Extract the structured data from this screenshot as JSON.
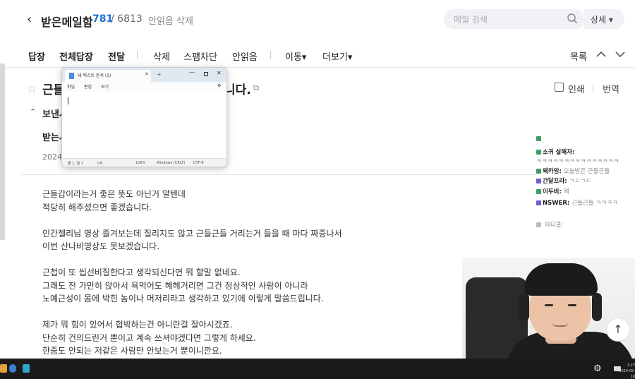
{
  "header": {
    "back_icon": "chevron-left-icon",
    "folder": "받은메일함",
    "unread_count": "781",
    "total_count": "/ 6813",
    "delete_unread": "안읽음 삭제",
    "search_placeholder": "메일 검색",
    "detail_label": "상세 ▾"
  },
  "toolbar": {
    "reply": "답장",
    "reply_all": "전체답장",
    "forward": "전달",
    "delete": "삭제",
    "block_spam": "스팸차단",
    "mark_unread": "안읽음",
    "move": "이동▾",
    "more": "더보기▾",
    "list": "목록",
    "prev_icon": "chevron-up-icon",
    "next_icon": "chevron-down-icon"
  },
  "message": {
    "subject_start": "근들",
    "subject_end": "니다.",
    "print": "인쇄",
    "translate": "번역",
    "sender_label": "보낸사",
    "recipient_label": "받는시",
    "date": "2024",
    "body": [
      "근들갑이라는거 좋은 뜻도 아닌거 알텐데",
      "적당히 해주셨으면 좋겠습니다.",
      "",
      "인간젤리님 영상 즐겨보는데 질리지도 않고 근들근들 거리는거 들을 때 마다 짜증나서",
      "이번 산나비영상도 못보겠습니다.",
      "",
      "근첩이 또 씹선비질한다고 생각되신다면 뭐 할말 없네요.",
      "그래도 전 가만히 앉아서 욕먹어도 헤헤거리면 그건 정상적인 사람이 아니라",
      "노예근성이 몸에 박힌 놈이나 머저리라고 생각하고 있기에 이렇게 말씀드립니다.",
      "",
      "제가 뭐 힘이 있어서 협박하는건 아니란걸 잘아시겠죠.",
      "단순히 건의드린거 뿐이고 계속 쓰셔야겠다면 그렇게 하세요.",
      "한줌도 안되는 저같은 사람만 안보는거 뿐이니깐요."
    ]
  },
  "notepad": {
    "tab_title": "새 텍스트 문서 (3)",
    "menu": [
      "파일",
      "편집",
      "보기"
    ],
    "status": [
      "줄 1, 열 1",
      "0자",
      "100%",
      "Windows (CRLF)",
      "UTF-8"
    ]
  },
  "chat": [
    {
      "name": "",
      "msg": "",
      "color": "#3f9e63"
    },
    {
      "name": "소귀 살해자:",
      "msg": "",
      "color": "#3f9e63"
    },
    {
      "name": "",
      "msg": "ㅋㅋㅋㅋㅋㅋㅋㅋㅋㅋㅋㅋㅋㅋㅋ",
      "color": ""
    },
    {
      "name": "왜카잉:",
      "msg": "오늘밤은 근들근들",
      "color": "#3f9e63"
    },
    {
      "name": "간달프라:",
      "msg": "ㄱㄷㄱㄷ",
      "color": "#7a59d1"
    },
    {
      "name": "이두비:",
      "msg": "웩",
      "color": "#3f9e63"
    },
    {
      "name": "NSWER:",
      "msg": "근들근들 ㅋㅋㅋㅋ",
      "color": "#7a59d1"
    },
    {
      "name": "",
      "msg": "아티클:",
      "color": "#bbbbbb"
    }
  ],
  "taskbar": {
    "time": "1:27",
    "date": "2024-05-10"
  }
}
